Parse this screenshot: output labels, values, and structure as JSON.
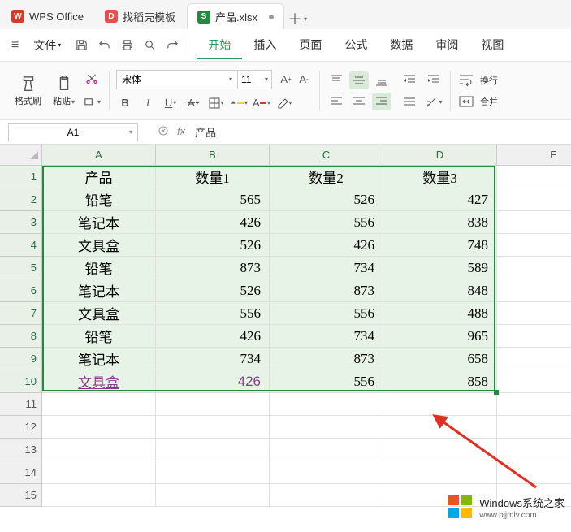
{
  "tabs": {
    "items": [
      {
        "label": "WPS Office",
        "icon_bg": "#d23c2a",
        "icon_text": "W"
      },
      {
        "label": "找稻壳模板",
        "icon_bg": "#e0524b",
        "icon_text": "D"
      },
      {
        "label": "产品.xlsx",
        "icon_bg": "#1f8b3e",
        "icon_text": "S"
      }
    ]
  },
  "menu": {
    "file": "文件",
    "items": [
      "开始",
      "插入",
      "页面",
      "公式",
      "数据",
      "审阅",
      "视图"
    ],
    "active_index": 0
  },
  "toolbar": {
    "format_painter": "格式刷",
    "paste": "粘贴",
    "font_name": "宋体",
    "font_size": "11",
    "wrap": "换行",
    "merge": "合并"
  },
  "name_box": {
    "value": "A1"
  },
  "formula_bar": {
    "fx": "fx",
    "value": "产品"
  },
  "grid": {
    "columns": [
      "A",
      "B",
      "C",
      "D",
      "E"
    ],
    "selected_cols": 4,
    "row_count": 15,
    "selected_rows": 10,
    "data": [
      [
        "产品",
        "数量1",
        "数量2",
        "数量3"
      ],
      [
        "铅笔",
        "565",
        "526",
        "427"
      ],
      [
        "笔记本",
        "426",
        "556",
        "838"
      ],
      [
        "文具盒",
        "526",
        "426",
        "748"
      ],
      [
        "铅笔",
        "873",
        "734",
        "589"
      ],
      [
        "笔记本",
        "526",
        "873",
        "848"
      ],
      [
        "文具盒",
        "556",
        "556",
        "488"
      ],
      [
        "铅笔",
        "426",
        "734",
        "965"
      ],
      [
        "笔记本",
        "734",
        "873",
        "658"
      ],
      [
        "文具盒",
        "426",
        "556",
        "858"
      ]
    ],
    "purple_row": 9
  },
  "watermark": {
    "title": "Windows系统之家",
    "sub": "www.bjjmlv.com"
  }
}
